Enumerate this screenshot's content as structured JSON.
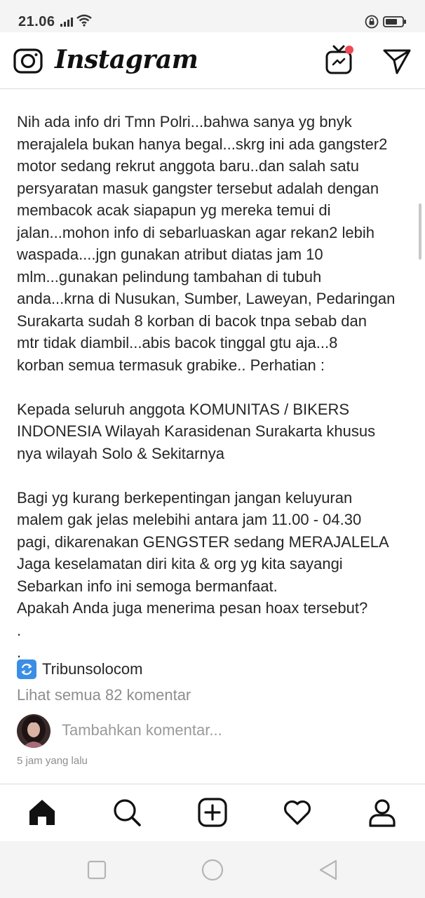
{
  "status_bar": {
    "time": "21.06"
  },
  "header": {
    "logo_text": "Instagram",
    "igtv_badge_color": "#ed4956"
  },
  "post": {
    "caption": "Nih ada info dri Tmn Polri...bahwa sanya yg bnyk\nmerajalela bukan hanya begal...skrg ini ada gangster2\nmotor sedang rekrut anggota baru..dan salah satu\npersyaratan masuk gangster tersebut adalah dengan\nmembacok acak siapapun yg mereka temui di\njalan...mohon info di sebarluaskan agar rekan2 lebih\nwaspada....jgn gunakan atribut diatas jam 10\nmlm...gunakan pelindung tambahan di tubuh\nanda...krna di Nusukan, Sumber, Laweyan, Pedaringan\nSurakarta sudah 8 korban di bacok tnpa sebab dan\nmtr tidak diambil...abis bacok tinggal gtu aja...8\nkorban semua termasuk grabike.. Perhatian :\n\nKepada seluruh anggota KOMUNITAS / BIKERS\nINDONESIA Wilayah Karasidenan Surakarta khusus\nnya wilayah Solo & Sekitarnya\n\nBagi yg kurang berkepentingan jangan keluyuran\nmalem gak jelas melebihi antara jam 11.00 - 04.30\npagi, dikarenakan GENGSTER sedang MERAJALELA\nJaga keselamatan diri kita & org yg kita sayangi\nSebarkan info ini semoga bermanfaat.\nApakah Anda juga menerima pesan hoax tersebut?\n.\n.",
    "repost_source": "Tribunsolocom",
    "view_all_comments": "Lihat semua 82 komentar",
    "add_comment_placeholder": "Tambahkan komentar...",
    "timestamp": "5 jam yang lalu"
  },
  "bottom_nav": {
    "items": [
      "home-icon",
      "search-icon",
      "add-post-icon",
      "activity-heart-icon",
      "profile-icon"
    ]
  },
  "system_nav": {
    "items": [
      "recents-square",
      "home-circle",
      "back-triangle"
    ]
  }
}
